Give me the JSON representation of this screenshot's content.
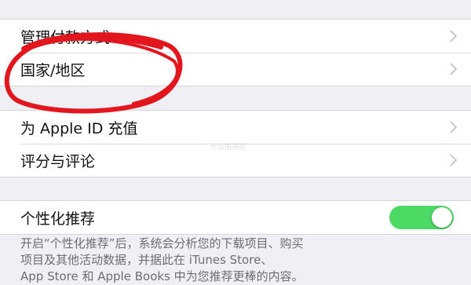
{
  "settings": {
    "group1": [
      {
        "label": "管理付款方式"
      },
      {
        "label": "国家/地区"
      }
    ],
    "group2": [
      {
        "label": "为 Apple ID 充值"
      },
      {
        "label": "评分与评论"
      }
    ],
    "group3": {
      "label": "个性化推荐",
      "toggle_on": true,
      "toggle_color": "#4cd964"
    },
    "footer_lines": [
      "开启“个性化推荐”后，系统会分析您的下载项目、购买",
      "项目及其他活动数据，并据此在 iTunes Store、",
      "App Store 和 Apple Books 中为您推荐更棒的内容。"
    ]
  },
  "annotation": {
    "color": "#e3161e",
    "shape": "hand-drawn circle"
  },
  "watermark": {
    "text": "什么值得买"
  }
}
